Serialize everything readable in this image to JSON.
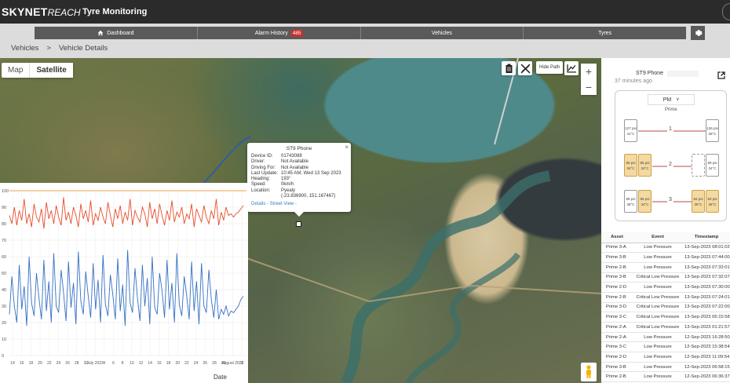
{
  "app": {
    "brand_bold": "SKYNET",
    "brand_light": "REACH",
    "title": "Tyre Monitoring"
  },
  "nav": {
    "items": [
      {
        "label": "Dashboard",
        "icon": "home-icon"
      },
      {
        "label": "Alarm History",
        "badge": "485"
      },
      {
        "label": "Vehicles"
      },
      {
        "label": "Tyres"
      }
    ],
    "settings_icon": "gear-icon"
  },
  "breadcrumb": {
    "items": [
      "Vehicles",
      ">",
      "Vehicle Details"
    ]
  },
  "map": {
    "type_toggle": [
      "Map",
      "Satellite"
    ],
    "selected_type": "Satellite",
    "tools": [
      "clipboard-icon",
      "hide-path-icon",
      "chart-line-icon"
    ],
    "hide_path_label": "Hide Path",
    "zoom_in": "+",
    "zoom_out": "−"
  },
  "popup": {
    "title": "ST9 Phone",
    "close": "×",
    "rows": [
      {
        "k": "Device ID:",
        "v": "01743088"
      },
      {
        "k": "Driver:",
        "v": "Not Available"
      },
      {
        "k": "Driving For:",
        "v": "Not Available"
      },
      {
        "k": "Last Update:",
        "v": "10:45 AM, Wed 13 Sep 2023"
      },
      {
        "k": "Heading:",
        "v": "193°"
      },
      {
        "k": "Speed:",
        "v": "0km/h"
      },
      {
        "k": "Location:",
        "v": "Pyealy"
      },
      {
        "k": "",
        "v": "(-23.836900, 151.167467)"
      }
    ],
    "links": "Details - Street View -"
  },
  "chart_data": {
    "type": "line",
    "xlabel": "Date",
    "ylabel": "",
    "ylim": [
      0,
      100
    ],
    "y_ticks": [
      0,
      10,
      20,
      30,
      40,
      50,
      60,
      70,
      80,
      90,
      100
    ],
    "x_ticks": [
      "14",
      "16",
      "18",
      "20",
      "22",
      "24",
      "26",
      "28",
      "30",
      "July 2023",
      "4",
      "6",
      "8",
      "10",
      "12",
      "14",
      "16",
      "18",
      "20",
      "22",
      "24",
      "26",
      "28",
      "30",
      "August 2023",
      "3"
    ],
    "legend": "none",
    "series": [
      {
        "color": "#e84c2a",
        "values": [
          85,
          80,
          90,
          79,
          88,
          82,
          95,
          80,
          86,
          78,
          92,
          84,
          81,
          89,
          77,
          93,
          83,
          88,
          80,
          91,
          84,
          79,
          96,
          82,
          87,
          80,
          90,
          85,
          78,
          92,
          83,
          88,
          81,
          94,
          79,
          86,
          82,
          90,
          84,
          80,
          93,
          85,
          78,
          89,
          83,
          91,
          80,
          87,
          82,
          95,
          79,
          88,
          84,
          81,
          90,
          86,
          78,
          93,
          83,
          89,
          80,
          92,
          85,
          79,
          88,
          82,
          94,
          81,
          87,
          84,
          90,
          80,
          86,
          83,
          92,
          78,
          89,
          85,
          81,
          91,
          84,
          80,
          88,
          83,
          95,
          79,
          87,
          82,
          90,
          85,
          86,
          84,
          86,
          87,
          89,
          91
        ]
      },
      {
        "color": "#3570c4",
        "values": [
          25,
          48,
          30,
          20,
          55,
          28,
          42,
          18,
          60,
          32,
          24,
          50,
          35,
          22,
          58,
          27,
          45,
          20,
          62,
          30,
          26,
          52,
          38,
          21,
          57,
          29,
          44,
          19,
          63,
          33,
          25,
          51,
          36,
          23,
          56,
          28,
          46,
          20,
          61,
          31,
          24,
          49,
          37,
          22,
          59,
          27,
          43,
          18,
          64,
          32,
          26,
          53,
          35,
          21,
          55,
          30,
          47,
          19,
          60,
          29,
          25,
          50,
          39,
          23,
          58,
          28,
          44,
          20,
          62,
          31,
          24,
          48,
          36,
          22,
          57,
          27,
          45,
          19,
          56,
          30,
          26,
          52,
          34,
          23,
          40,
          22,
          28,
          25,
          30,
          24,
          27,
          26,
          28,
          30,
          34,
          36
        ]
      }
    ],
    "reference_line": {
      "color": "#f0a04a",
      "y": 100
    }
  },
  "device": {
    "name": "ST9 Phone",
    "ago": "37 minutes ago",
    "link_icon": "external-link-icon"
  },
  "tyres": {
    "selector": "PM",
    "selector_caret": "˅",
    "group": "Prime",
    "axles": [
      {
        "num": "1",
        "tyres": [
          {
            "psi": "127 psi",
            "temp": "41°C",
            "warn": false
          },
          {
            "psi": "126 psi",
            "temp": "39°C",
            "warn": false
          }
        ]
      },
      {
        "num": "2",
        "tyres": [
          {
            "psi": "65 psi",
            "temp": "34°C",
            "warn": true
          },
          {
            "psi": "85 psi",
            "temp": "34°C",
            "warn": true
          },
          {
            "psi": "",
            "temp": "",
            "warn": false,
            "empty": true
          },
          {
            "psi": "89 psi",
            "temp": "34°C",
            "warn": false
          }
        ]
      },
      {
        "num": "3",
        "tyres": [
          {
            "psi": "89 psi",
            "temp": "38°C",
            "warn": false
          },
          {
            "psi": "85 psi",
            "temp": "34°C",
            "warn": true
          },
          {
            "psi": "84 psi",
            "temp": "35°C",
            "warn": true
          },
          {
            "psi": "83 psi",
            "temp": "35°C",
            "warn": true
          }
        ]
      }
    ]
  },
  "events": {
    "headers": [
      "Asset",
      "Event",
      "Timestamp"
    ],
    "rows": [
      [
        "Prime 3-A",
        "Low Pressure",
        "13-Sep-2023 08:01:02"
      ],
      [
        "Prime 3-B",
        "Low Pressure",
        "13-Sep-2023 07:44:00"
      ],
      [
        "Prime 2-B",
        "Low Pressure",
        "13-Sep-2023 07:33:01"
      ],
      [
        "Prime 3-B",
        "Critical Low Pressure",
        "13-Sep-2023 07:32:07"
      ],
      [
        "Prime 2-D",
        "Low Pressure",
        "13-Sep-2023 07:30:00"
      ],
      [
        "Prime 2-B",
        "Critical Low Pressure",
        "13-Sep-2023 07:24:01"
      ],
      [
        "Prime 3-D",
        "Critical Low Pressure",
        "13-Sep-2023 07:22:00"
      ],
      [
        "Prime 3-C",
        "Critical Low Pressure",
        "13-Sep-2023 06:15:58"
      ],
      [
        "Prime 2-A",
        "Critical Low Pressure",
        "13-Sep-2023 01:21:57"
      ],
      [
        "Prime 2-A",
        "Low Pressure",
        "12-Sep-2023 16:28:50"
      ],
      [
        "Prime 3-C",
        "Low Pressure",
        "12-Sep-2023 15:38:54"
      ],
      [
        "Prime 2-D",
        "Low Pressure",
        "12-Sep-2023 11:09:54"
      ],
      [
        "Prime 3-B",
        "Low Pressure",
        "12-Sep-2023 06:58:15"
      ],
      [
        "Prime 2-B",
        "Low Pressure",
        "12-Sep-2023 06:36:37"
      ]
    ]
  }
}
